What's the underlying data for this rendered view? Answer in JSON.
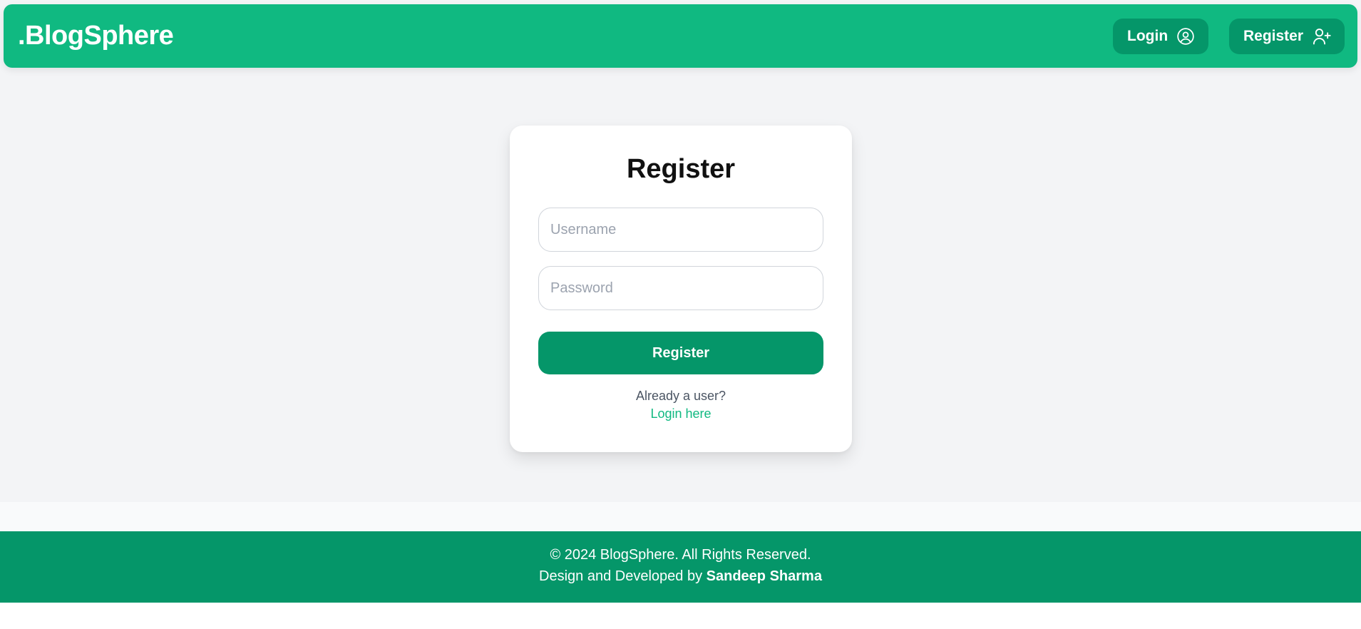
{
  "header": {
    "brand": ".BlogSphere",
    "login_label": "Login",
    "register_label": "Register",
    "login_icon": "user-circle-icon",
    "register_icon": "user-plus-icon"
  },
  "form": {
    "title": "Register",
    "username_placeholder": "Username",
    "username_value": "",
    "password_placeholder": "Password",
    "password_value": "",
    "submit_label": "Register",
    "already_text": "Already a user?",
    "login_link": "Login here"
  },
  "footer": {
    "copyright": "© 2024 BlogSphere. All Rights Reserved.",
    "credit_prefix": "Design and Developed by",
    "credit_name": "Sandeep Sharma"
  },
  "colors": {
    "primary": "#10b981",
    "primary_dark": "#059669",
    "background": "#f3f4f6"
  }
}
